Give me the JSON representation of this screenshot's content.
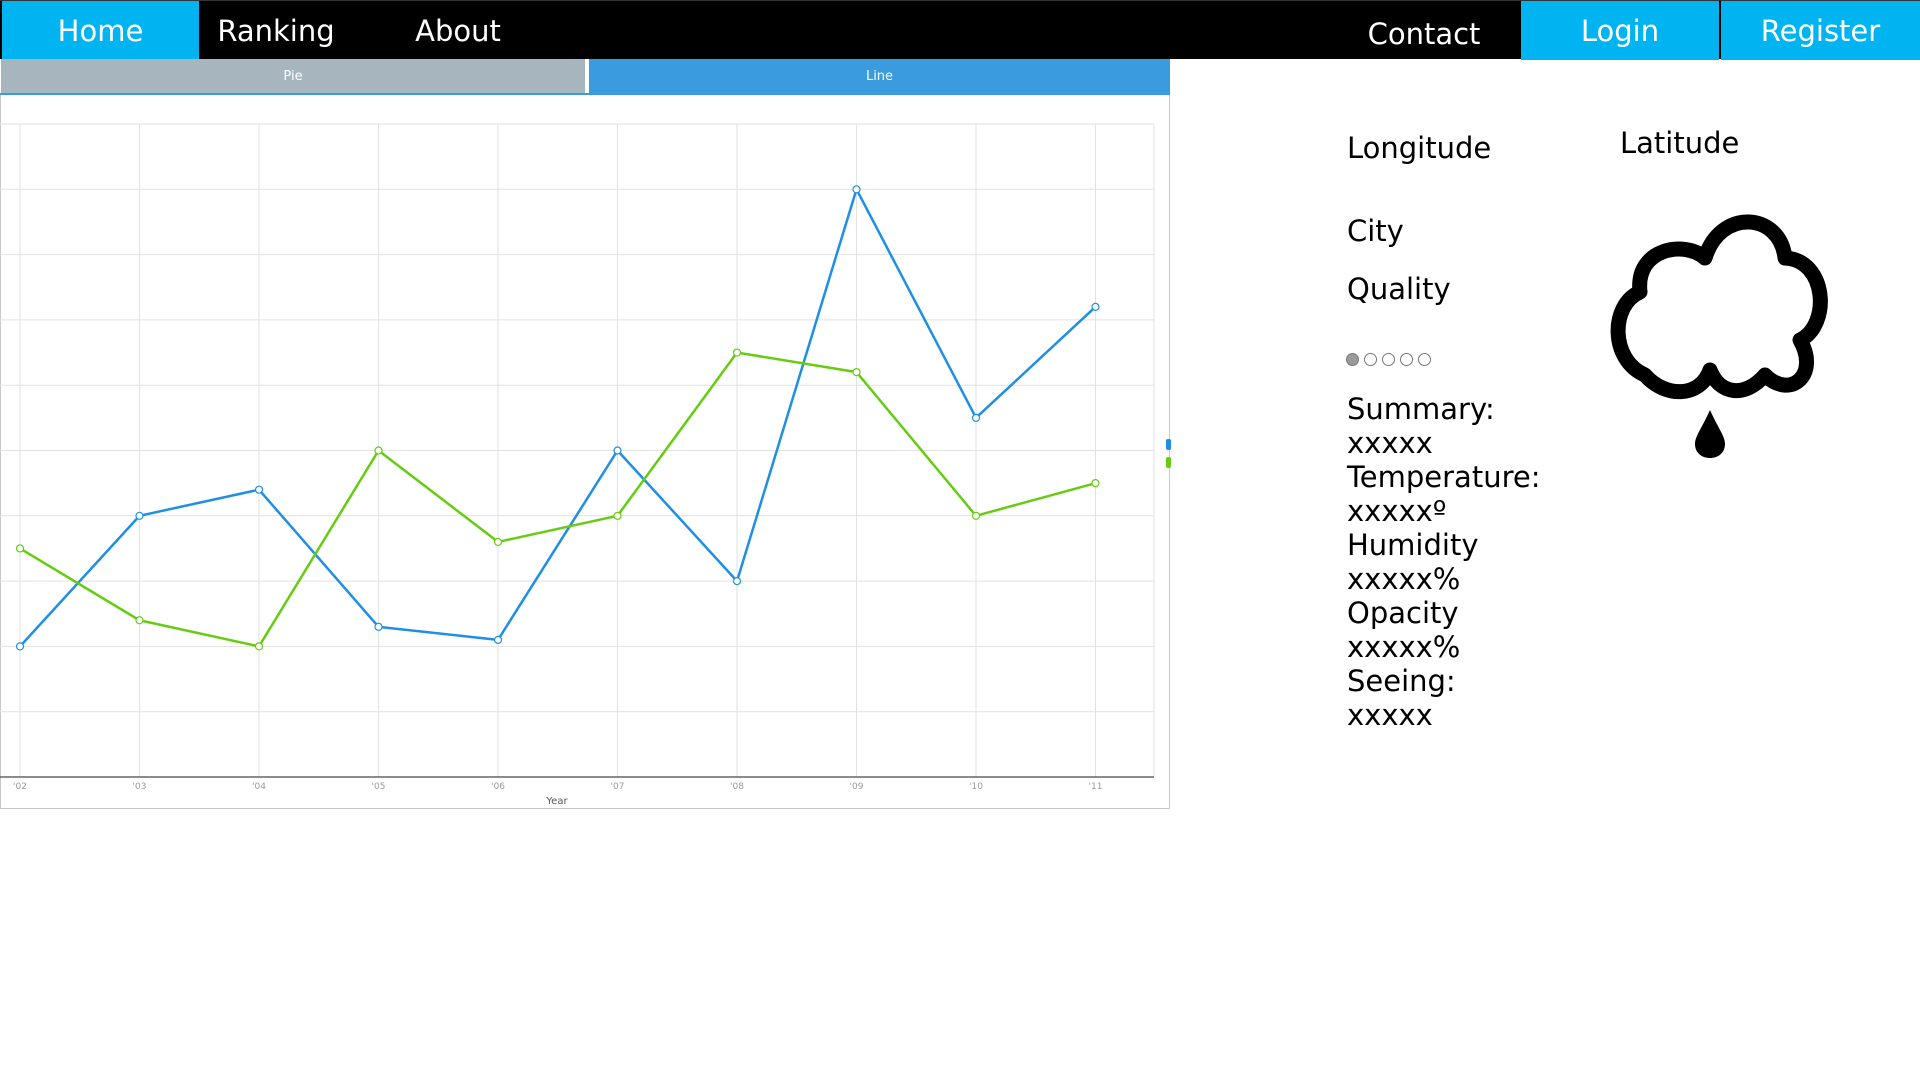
{
  "nav": {
    "home": "Home",
    "ranking": "Ranking",
    "about": "About",
    "contact": "Contact",
    "login": "Login",
    "register": "Register"
  },
  "tabs": {
    "pie": "Pie",
    "line": "Line",
    "active": "Line"
  },
  "info": {
    "longitude_label": "Longitude",
    "latitude_label": "Latitude",
    "city_label": "City",
    "quality_label": "Quality",
    "quality_rating": {
      "filled": 1,
      "total": 5
    },
    "summary_label": "Summary:",
    "summary_value": "xxxxx",
    "temperature_label": "Temperature:",
    "temperature_value": "xxxxxº",
    "humidity_label": "Humidity",
    "humidity_value": "xxxxx%",
    "opacity_label": "Opacity",
    "opacity_value": "xxxxx%",
    "seeing_label": "Seeing:",
    "seeing_value": "xxxxx",
    "weather_icon": "cloud-rain-icon"
  },
  "colors": {
    "nav_background": "#000000",
    "nav_accent": "#00b4f2",
    "tab_inactive": "#a7b5bf",
    "tab_active": "#3b9bdf",
    "series_blue": "#1f8fe6",
    "series_green": "#66cc11"
  },
  "chart_data": {
    "type": "line",
    "xlabel": "Year",
    "ylabel": "",
    "title": "",
    "x": [
      "'02",
      "'03",
      "'04",
      "'05",
      "'06",
      "'07",
      "'08",
      "'09",
      "'10",
      "'11"
    ],
    "ylim": [
      0,
      10
    ],
    "grid": true,
    "series": [
      {
        "color": "#1f8fe6",
        "values": [
          2.0,
          4.0,
          4.4,
          2.3,
          2.1,
          5.0,
          3.0,
          9.0,
          5.5,
          7.2
        ]
      },
      {
        "color": "#66cc11",
        "values": [
          3.5,
          2.4,
          2.0,
          5.0,
          3.6,
          4.0,
          6.5,
          6.2,
          4.0,
          4.5
        ]
      }
    ]
  }
}
